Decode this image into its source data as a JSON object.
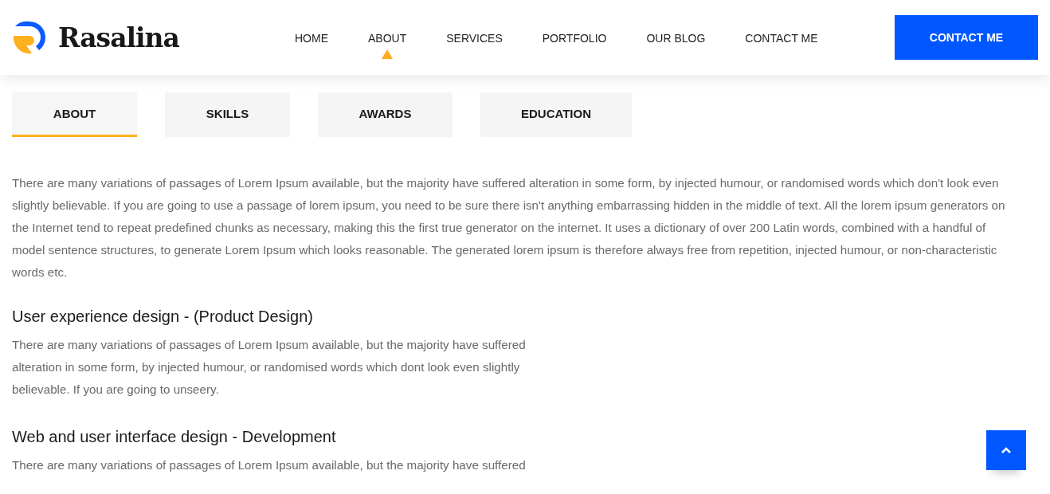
{
  "header": {
    "brand": "Rasalina",
    "nav": [
      {
        "label": "HOME",
        "selected": false
      },
      {
        "label": "ABOUT",
        "selected": true
      },
      {
        "label": "SERVICES",
        "selected": false
      },
      {
        "label": "PORTFOLIO",
        "selected": false
      },
      {
        "label": "OUR BLOG",
        "selected": false
      },
      {
        "label": "CONTACT ME",
        "selected": false
      }
    ],
    "cta": "CONTACT ME"
  },
  "tabs": [
    {
      "label": "ABOUT",
      "selected": true
    },
    {
      "label": "SKILLS",
      "selected": false
    },
    {
      "label": "AWARDS",
      "selected": false
    },
    {
      "label": "EDUCATION",
      "selected": false
    }
  ],
  "intro": "There are many variations of passages of Lorem Ipsum available, but the majority have suffered alteration in some form, by injected humour, or randomised words which don't look even slightly believable. If you are going to use a passage of lorem ipsum, you need to be sure there isn't anything embarrassing hidden in the middle of text. All the lorem ipsum generators on the Internet tend to repeat predefined chunks as necessary, making this the first true generator on the internet. It uses a dictionary of over 200 Latin words, combined with a handful of model sentence structures, to generate Lorem Ipsum which looks reasonable. The generated lorem ipsum is therefore always free from repetition, injected humour, or non-characteristic words etc.",
  "sections": [
    {
      "title": "User experience design - (Product Design)",
      "text": "There are many variations of passages of Lorem Ipsum available, but the majority have suffered alteration in some form, by injected humour, or randomised words which dont look even slightly believable. If you are going to unseery."
    },
    {
      "title": "Web and user interface design - Development",
      "text": "There are many variations of passages of Lorem Ipsum available, but the majority have suffered"
    }
  ]
}
